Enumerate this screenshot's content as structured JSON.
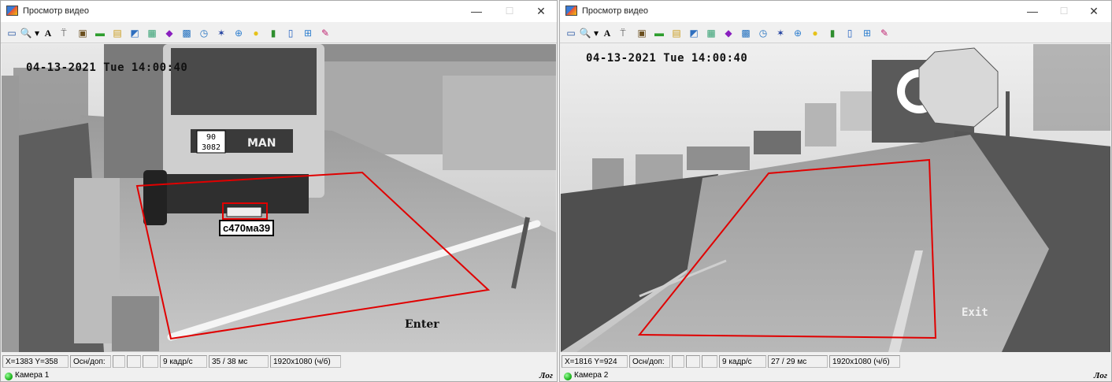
{
  "windows": [
    {
      "title": "Просмотр видео",
      "timestamp": "04-13-2021 Tue 14:00:40",
      "plate": "с470ма39",
      "direction_label": "Enter",
      "status": {
        "coords": "X=1383 Y=358",
        "mode": "Осн/доп:",
        "fps": "9 кадр/с",
        "latency": "35 / 38 мс",
        "resolution": "1920x1080 (ч/б)"
      },
      "camera": "Камера 1",
      "log": "Лог"
    },
    {
      "title": "Просмотр видео",
      "timestamp": "04-13-2021 Tue 14:00:40",
      "direction_label": "Exit",
      "status": {
        "coords": "X=1816 Y=924",
        "mode": "Осн/доп:",
        "fps": "9 кадр/с",
        "latency": "27 / 29 мс",
        "resolution": "1920x1080 (ч/б)"
      },
      "camera": "Камера 2",
      "log": "Лог"
    }
  ],
  "window_controls": {
    "minimize": "—",
    "maximize": "☐",
    "close": "✕"
  },
  "toolbar": [
    {
      "icon": "video-icon",
      "glyph": "▭",
      "color": "#1f4f9f"
    },
    {
      "icon": "zoom-icon",
      "glyph": "🔍",
      "color": "#1f4f9f"
    },
    {
      "icon": "dropdown-icon",
      "glyph": "▾",
      "color": "#000000"
    },
    {
      "icon": "text-icon",
      "glyph": "A",
      "color": "#000000"
    },
    {
      "icon": "antenna-icon",
      "glyph": "⍡",
      "color": "#444444"
    },
    {
      "icon": "settings-icon",
      "glyph": "▣",
      "color": "#6b4f1f"
    },
    {
      "icon": "truck-icon",
      "glyph": "▬",
      "color": "#2e9e2e"
    },
    {
      "icon": "folder-icon",
      "glyph": "▤",
      "color": "#c99a1a"
    },
    {
      "icon": "save-icon",
      "glyph": "◩",
      "color": "#2f6fbf"
    },
    {
      "icon": "grid-icon",
      "glyph": "▦",
      "color": "#2e9e6e"
    },
    {
      "icon": "car-icon",
      "glyph": "◆",
      "color": "#8a1fbf"
    },
    {
      "icon": "display-icon",
      "glyph": "▩",
      "color": "#1f6fbf"
    },
    {
      "icon": "clock-icon",
      "glyph": "◷",
      "color": "#1f6fbf"
    },
    {
      "icon": "runner-icon",
      "glyph": "✶",
      "color": "#1f3f9f"
    },
    {
      "icon": "search-icon",
      "glyph": "⊕",
      "color": "#2f7fcf"
    },
    {
      "icon": "bulb-icon",
      "glyph": "●",
      "color": "#e6c21a"
    },
    {
      "icon": "traffic-light-icon",
      "glyph": "▮",
      "color": "#2e8e2e"
    },
    {
      "icon": "document-icon",
      "glyph": "▯",
      "color": "#1f5fbf"
    },
    {
      "icon": "network-icon",
      "glyph": "⊞",
      "color": "#2f7fcf"
    },
    {
      "icon": "edit-icon",
      "glyph": "✎",
      "color": "#bf1f6f"
    }
  ]
}
